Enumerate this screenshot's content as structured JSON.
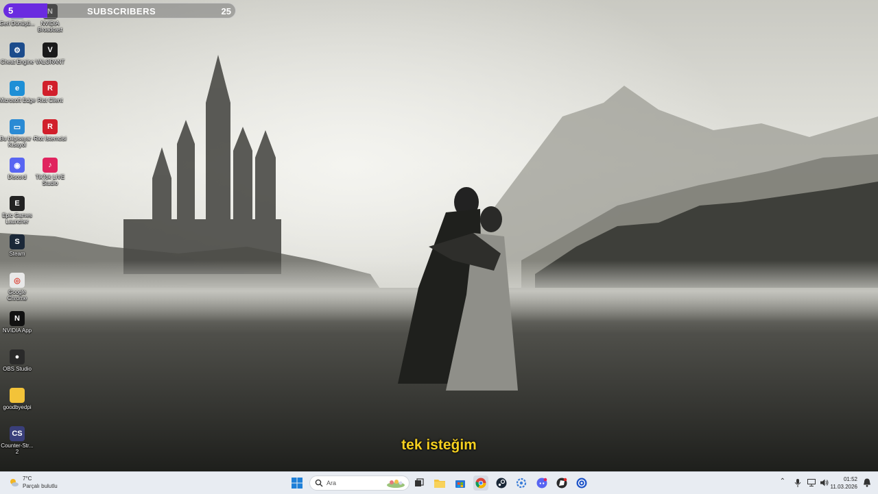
{
  "subscribers_widget": {
    "current": "5",
    "title": "SUBSCRIBERS",
    "goal": "25",
    "progress_fraction": 0.2,
    "bar_color": "#6a2be0"
  },
  "desktop_icons": [
    {
      "label": "Geri Dönüşü...",
      "icon": "recycle-bin-icon"
    },
    {
      "label": "NVIDIA Broadcast",
      "icon": "nvidia-broadcast-icon"
    },
    {
      "label": "Cheat Engine",
      "icon": "cheat-engine-icon"
    },
    {
      "label": "VALORANT",
      "icon": "valorant-icon"
    },
    {
      "label": "Microsoft Edge",
      "icon": "edge-icon"
    },
    {
      "label": "Riot Client",
      "icon": "riot-client-icon"
    },
    {
      "label": "Bu bilgisayar - Kısayol",
      "icon": "this-pc-icon"
    },
    {
      "label": "Riot İstemcisi",
      "icon": "riot-client-icon"
    },
    {
      "label": "Discord",
      "icon": "discord-icon"
    },
    {
      "label": "TikTok LIVE Studio",
      "icon": "tiktok-live-icon"
    },
    {
      "label": "Epic Games Launcher",
      "icon": "epic-games-icon"
    },
    {
      "label": "Steam",
      "icon": "steam-icon"
    },
    {
      "label": "Google Chrome",
      "icon": "chrome-icon"
    },
    {
      "label": "NVIDIA App",
      "icon": "nvidia-app-icon"
    },
    {
      "label": "OBS Studio",
      "icon": "obs-icon"
    },
    {
      "label": "goodbyedpi",
      "icon": "folder-icon"
    },
    {
      "label": "Counter-Str... 2",
      "icon": "cs2-icon"
    }
  ],
  "subtitle": "tek isteğim",
  "taskbar": {
    "weather_temp": "7°C",
    "weather_condition": "Parçalı bulutlu",
    "search_placeholder": "Ara",
    "pinned": [
      "windows-start-icon",
      "task-view-icon",
      "file-explorer-icon",
      "microsoft-store-icon",
      "chrome-icon",
      "steam-icon",
      "settings-icon",
      "discord-icon",
      "riot-client-icon",
      "browser-icon"
    ],
    "time": "01:52",
    "date": "11.03.2026"
  }
}
